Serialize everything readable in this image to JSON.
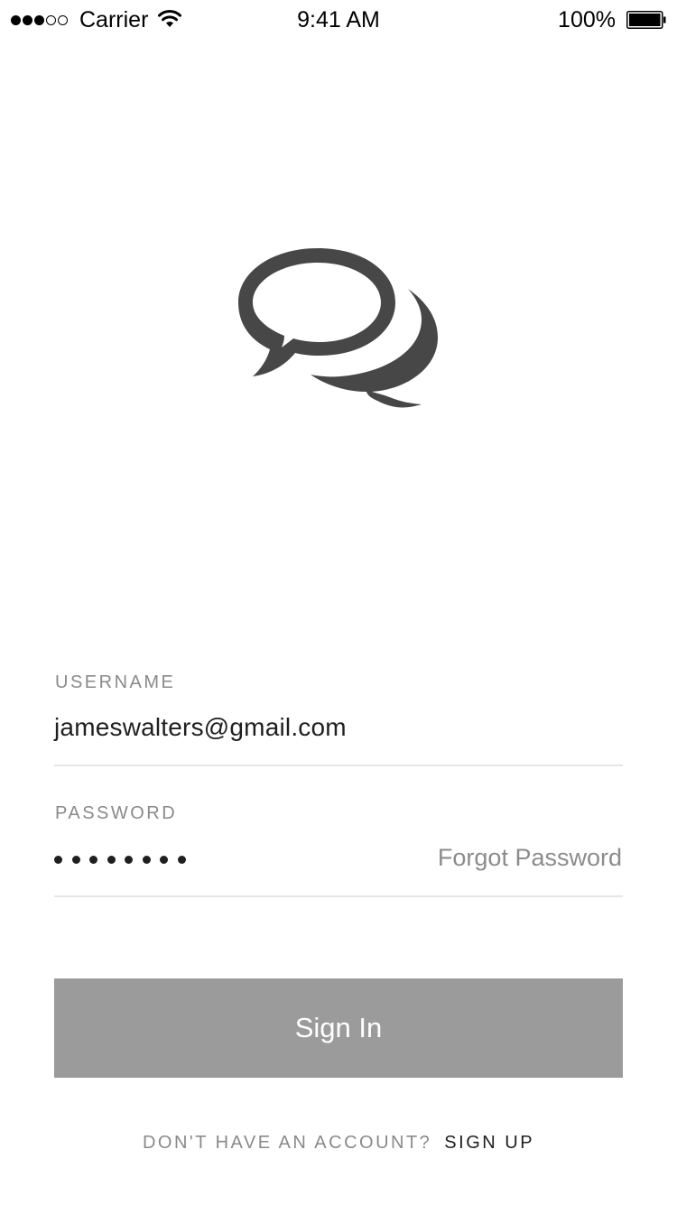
{
  "status_bar": {
    "signal": {
      "filled": 3,
      "empty": 2
    },
    "carrier": "Carrier",
    "time": "9:41 AM",
    "battery_percent": "100%",
    "battery_level": 1.0
  },
  "logo": {
    "icon": "chat-bubbles-icon",
    "color": "#474747"
  },
  "form": {
    "username": {
      "label": "USERNAME",
      "value": "jameswalters@gmail.com"
    },
    "password": {
      "label": "PASSWORD",
      "masked_length": 8,
      "forgot_label": "Forgot Password"
    },
    "sign_in_label": "Sign In",
    "button_color": "#9b9b9b"
  },
  "footer": {
    "question": "DON'T HAVE AN ACCOUNT?",
    "sign_up_label": "SIGN UP"
  }
}
